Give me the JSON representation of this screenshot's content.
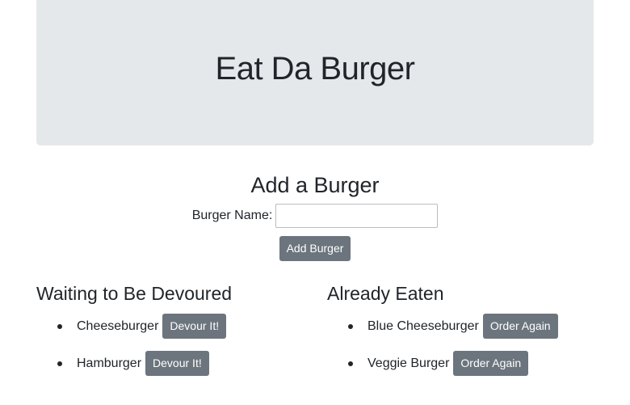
{
  "header": {
    "title": "Eat Da Burger"
  },
  "add_form": {
    "heading": "Add a Burger",
    "label": "Burger Name:",
    "input_value": "",
    "button_label": "Add Burger"
  },
  "waiting": {
    "heading": "Waiting to Be Devoured",
    "items": [
      {
        "name": "Cheeseburger",
        "button": "Devour It!"
      },
      {
        "name": "Hamburger",
        "button": "Devour It!"
      }
    ]
  },
  "eaten": {
    "heading": "Already Eaten",
    "items": [
      {
        "name": "Blue Cheeseburger",
        "button": "Order Again"
      },
      {
        "name": "Veggie Burger",
        "button": "Order Again"
      }
    ]
  },
  "colors": {
    "jumbotron_bg": "#e5e8eb",
    "button_bg": "#6c757d",
    "text": "#212529"
  }
}
